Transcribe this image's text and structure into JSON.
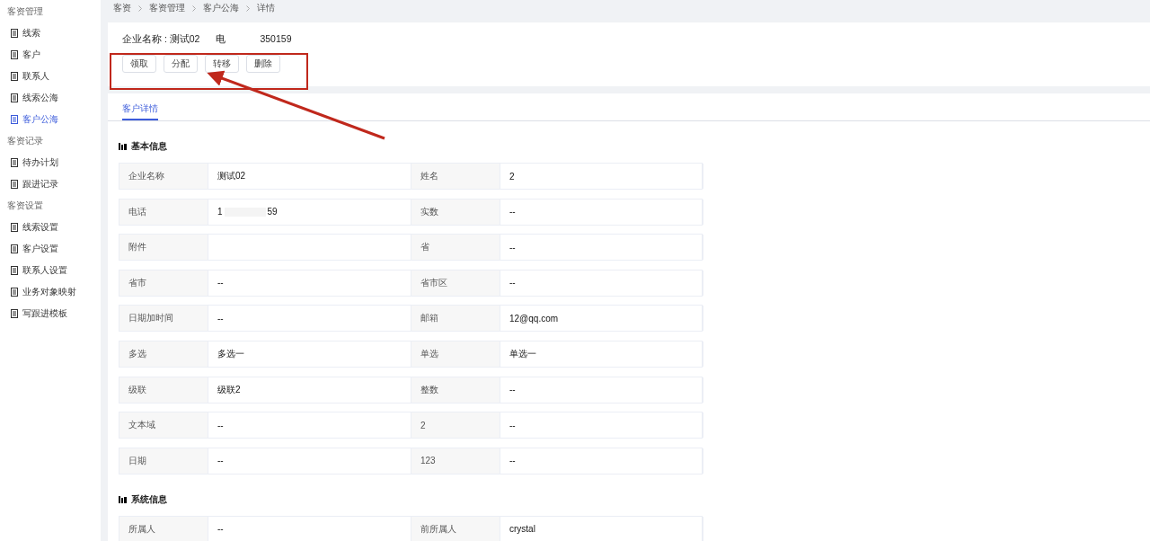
{
  "sidebar": {
    "groups": [
      {
        "title": "客资管理",
        "items": [
          {
            "label": "线索",
            "selected": false
          },
          {
            "label": "客户",
            "selected": false
          },
          {
            "label": "联系人",
            "selected": false
          },
          {
            "label": "线索公海",
            "selected": false
          },
          {
            "label": "客户公海",
            "selected": true
          }
        ]
      },
      {
        "title": "客资记录",
        "items": [
          {
            "label": "待办计划",
            "selected": false
          },
          {
            "label": "跟进记录",
            "selected": false
          }
        ]
      },
      {
        "title": "客资设置",
        "items": [
          {
            "label": "线索设置",
            "selected": false
          },
          {
            "label": "客户设置",
            "selected": false
          },
          {
            "label": "联系人设置",
            "selected": false
          },
          {
            "label": "业务对象映射",
            "selected": false
          },
          {
            "label": "写跟进模板",
            "selected": false
          }
        ]
      }
    ]
  },
  "breadcrumb": [
    "客资",
    "客资管理",
    "客户公海",
    "详情"
  ],
  "header": {
    "company": "企业名称 : 测试02",
    "phone_label": "电",
    "phone_value": "350159"
  },
  "actions": [
    "领取",
    "分配",
    "转移",
    "删除"
  ],
  "tabs": [
    {
      "label": "客户详情",
      "selected": true
    }
  ],
  "sections": [
    {
      "title": "基本信息",
      "rows": [
        [
          "企业名称",
          "测试02",
          "姓名",
          "2"
        ],
        [
          "电话",
          [
            "1",
            "59"
          ],
          "实数",
          "--"
        ],
        [
          "附件",
          "",
          "省",
          "--"
        ],
        [
          "省市",
          "--",
          "省市区",
          "--"
        ],
        [
          "日期加时间",
          "--",
          "邮箱",
          "12@qq.com"
        ],
        [
          "多选",
          "多选一",
          "单选",
          "单选一"
        ],
        [
          "级联",
          "级联2",
          "整数",
          "--"
        ],
        [
          "文本域",
          "--",
          "2",
          "--"
        ],
        [
          "日期",
          "--",
          "123",
          "--"
        ]
      ]
    },
    {
      "title": "系统信息",
      "rows": [
        [
          "所属人",
          "--",
          "前所属人",
          "crystal"
        ]
      ]
    }
  ]
}
